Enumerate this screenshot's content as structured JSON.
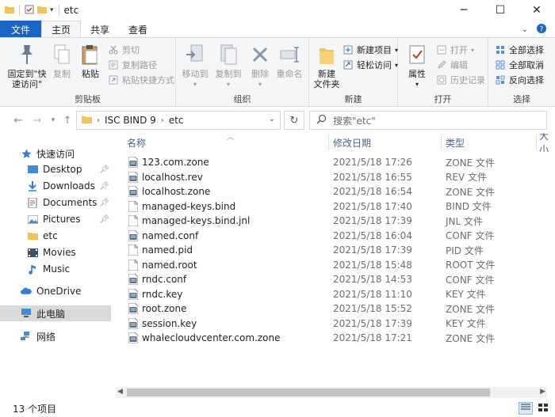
{
  "window": {
    "title": "etc"
  },
  "tabs": {
    "file": "文件",
    "home": "主页",
    "share": "共享",
    "view": "查看"
  },
  "ribbon": {
    "pin_quick": "固定到\"快速访问\"",
    "copy": "复制",
    "paste": "粘贴",
    "cut": "剪切",
    "copy_path": "复制路径",
    "paste_shortcut": "粘贴快捷方式",
    "clipboard_group": "剪贴板",
    "move_to": "移动到",
    "copy_to": "复制到",
    "delete": "删除",
    "rename": "重命名",
    "organize_group": "组织",
    "new_folder": "新建\n文件夹",
    "new_item": "新建项目",
    "easy_access": "轻松访问",
    "new_group": "新建",
    "properties": "属性",
    "open": "打开",
    "edit": "编辑",
    "history": "历史记录",
    "open_group": "打开",
    "select_all": "全部选择",
    "select_none": "全部取消",
    "invert_selection": "反向选择",
    "select_group": "选择"
  },
  "address": {
    "crumbs": [
      "ISC BIND 9",
      "etc"
    ]
  },
  "search": {
    "placeholder": "搜索\"etc\""
  },
  "nav": {
    "items": [
      {
        "label": "快速访问",
        "icon": "star-icon",
        "pinned": false,
        "indent": 0
      },
      {
        "label": "Desktop",
        "icon": "desktop-icon",
        "pinned": true,
        "indent": 1
      },
      {
        "label": "Downloads",
        "icon": "download-icon",
        "pinned": true,
        "indent": 1
      },
      {
        "label": "Documents",
        "icon": "documents-icon",
        "pinned": true,
        "indent": 1
      },
      {
        "label": "Pictures",
        "icon": "pictures-icon",
        "pinned": true,
        "indent": 1
      },
      {
        "label": "etc",
        "icon": "folder-icon",
        "pinned": false,
        "indent": 1
      },
      {
        "label": "Movies",
        "icon": "movies-icon",
        "pinned": false,
        "indent": 1
      },
      {
        "label": "Music",
        "icon": "music-icon",
        "pinned": false,
        "indent": 1
      },
      {
        "label": "OneDrive",
        "icon": "cloud-icon",
        "pinned": false,
        "indent": 0
      },
      {
        "label": "此电脑",
        "icon": "computer-icon",
        "pinned": false,
        "indent": 0
      },
      {
        "label": "网络",
        "icon": "network-icon",
        "pinned": false,
        "indent": 0
      }
    ]
  },
  "columns": {
    "name": "名称",
    "date": "修改日期",
    "type": "类型",
    "size": "大小"
  },
  "files": [
    {
      "name": "123.com.zone",
      "date": "2021/5/18 17:26",
      "type": "ZONE 文件",
      "icon": "data-file-icon"
    },
    {
      "name": "localhost.rev",
      "date": "2021/5/18 16:55",
      "type": "REV 文件",
      "icon": "data-file-icon"
    },
    {
      "name": "localhost.zone",
      "date": "2021/5/18 16:54",
      "type": "ZONE 文件",
      "icon": "data-file-icon"
    },
    {
      "name": "managed-keys.bind",
      "date": "2021/5/18 17:40",
      "type": "BIND 文件",
      "icon": "blank-file-icon"
    },
    {
      "name": "managed-keys.bind.jnl",
      "date": "2021/5/18 17:39",
      "type": "JNL 文件",
      "icon": "blank-file-icon"
    },
    {
      "name": "named.conf",
      "date": "2021/5/18 16:04",
      "type": "CONF 文件",
      "icon": "data-file-icon"
    },
    {
      "name": "named.pid",
      "date": "2021/5/18 17:39",
      "type": "PID 文件",
      "icon": "blank-file-icon"
    },
    {
      "name": "named.root",
      "date": "2021/5/18 15:48",
      "type": "ROOT 文件",
      "icon": "blank-file-icon"
    },
    {
      "name": "rndc.conf",
      "date": "2021/5/18 14:53",
      "type": "CONF 文件",
      "icon": "data-file-icon"
    },
    {
      "name": "rndc.key",
      "date": "2021/5/18 11:10",
      "type": "KEY 文件",
      "icon": "data-file-icon"
    },
    {
      "name": "root.zone",
      "date": "2021/5/18 15:52",
      "type": "ZONE 文件",
      "icon": "data-file-icon"
    },
    {
      "name": "session.key",
      "date": "2021/5/18 17:39",
      "type": "KEY 文件",
      "icon": "data-file-icon"
    },
    {
      "name": "whalecloudvcenter.com.zone",
      "date": "2021/5/18 17:21",
      "type": "ZONE 文件",
      "icon": "data-file-icon"
    }
  ],
  "status": {
    "count": "13 个项目"
  },
  "colors": {
    "accent": "#1a64c8",
    "folder": "#f3c35a",
    "selected": "#d9d9d9"
  }
}
